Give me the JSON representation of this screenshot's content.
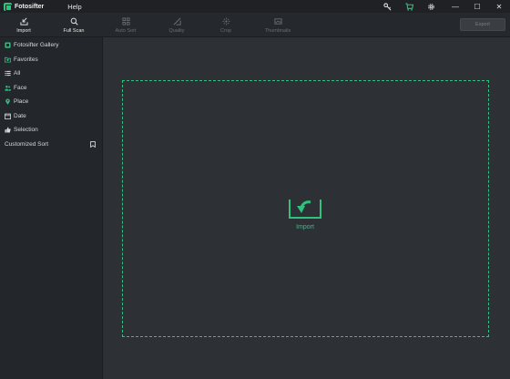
{
  "app": {
    "name": "Fotosifter",
    "menu_help": "Help"
  },
  "title_icons": [
    "key-icon",
    "cart-icon",
    "gear-icon"
  ],
  "window_controls": {
    "minimize": "—",
    "maximize": "☐",
    "close": "✕"
  },
  "toolbar": {
    "import": "Import",
    "full_scan": "Full Scan",
    "auto_sort": "Auto Sort",
    "quality": "Quality",
    "crop": "Crop",
    "thumbnails": "Thumbnails",
    "export": "Export"
  },
  "sidebar": {
    "items": [
      {
        "label": "Fotosifter Gallery",
        "icon": "gallery-icon"
      },
      {
        "label": "Favorites",
        "icon": "heart-folder-icon"
      },
      {
        "label": "All",
        "icon": "list-icon"
      },
      {
        "label": "Face",
        "icon": "people-icon"
      },
      {
        "label": "Place",
        "icon": "location-pin-icon"
      },
      {
        "label": "Date",
        "icon": "calendar-icon"
      },
      {
        "label": "Selection",
        "icon": "thumbs-up-icon"
      }
    ],
    "customized_sort": "Customized Sort"
  },
  "main": {
    "import_label": "Import"
  },
  "colors": {
    "accent": "#2ec27e",
    "background": "#2d3035",
    "sidebar": "#23262a",
    "titlebar": "#1f2125"
  }
}
